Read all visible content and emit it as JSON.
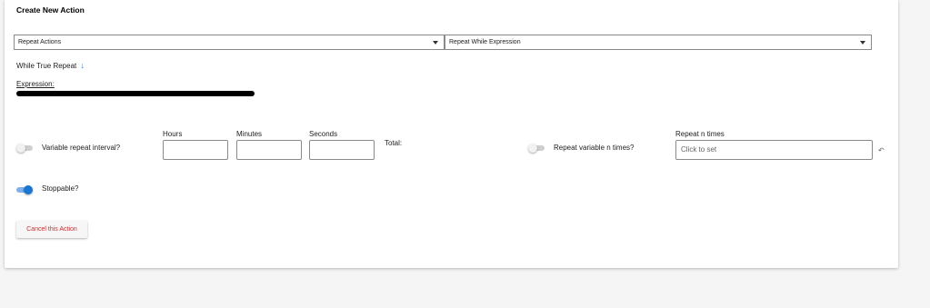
{
  "card": {
    "title": "Create New Action"
  },
  "selects": {
    "action_type": "Repeat Actions",
    "repeat_type": "Repeat While Expression"
  },
  "while_repeat": {
    "label": "While True Repeat",
    "icon": "arrow-down-icon"
  },
  "expression": {
    "label": "Expression:"
  },
  "variable_interval": {
    "label": "Variable repeat interval?",
    "enabled": false
  },
  "interval_fields": {
    "hours_label": "Hours",
    "minutes_label": "Minutes",
    "seconds_label": "Seconds",
    "total_label": "Total:"
  },
  "repeat_variable_n": {
    "label": "Repeat variable n times?",
    "enabled": false
  },
  "repeat_n_times": {
    "label": "Repeat n times",
    "placeholder": "Click to set",
    "icon": "undo-icon"
  },
  "stoppable": {
    "label": "Stoppable?",
    "enabled": true
  },
  "actions": {
    "cancel_label": "Cancel this Action"
  },
  "colors": {
    "accent": "#1976d2",
    "danger": "#d32f2f"
  }
}
